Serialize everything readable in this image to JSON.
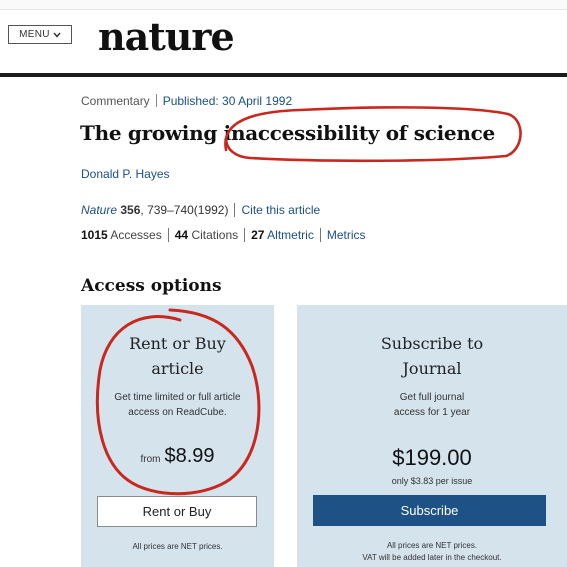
{
  "header": {
    "menu_label": "MENU",
    "logo": "nature"
  },
  "article": {
    "type": "Commentary",
    "published": "Published: 30 April 1992",
    "title": "The growing inaccessibility of science",
    "author": "Donald P. Hayes",
    "citation": {
      "journal": "Nature",
      "volume": "356",
      "pages": ", 739–740(1992)",
      "cite_link": "Cite this article"
    },
    "metrics": {
      "accesses_count": "1015",
      "accesses_label": "Accesses",
      "citations_count": "44",
      "citations_label": "Citations",
      "altmetric_count": "27",
      "altmetric_label": "Altmetric",
      "metrics_link": "Metrics"
    }
  },
  "access": {
    "heading": "Access options",
    "rent": {
      "title_line1": "Rent or Buy",
      "title_line2": "article",
      "desc_line1": "Get time limited or full article",
      "desc_line2": "access on ReadCube.",
      "from_label": "from",
      "price": "$8.99",
      "button": "Rent or Buy",
      "fine_print": "All prices are NET prices."
    },
    "subscribe": {
      "title_line1": "Subscribe to",
      "title_line2": "Journal",
      "desc_line1": "Get full journal",
      "desc_line2": "access for 1 year",
      "price": "$199.00",
      "per_issue": "only $3.83 per issue",
      "button": "Subscribe",
      "fine_print_line1": "All prices are NET prices.",
      "fine_print_line2": "VAT will be added later in the checkout."
    }
  },
  "colors": {
    "link": "#1d4f86",
    "card_bg": "#d4e3ec",
    "subscribe_button": "#1e5286",
    "annotation_ink": "#c8281e"
  },
  "icons": {
    "menu_chevron": "chevron-down-icon"
  }
}
